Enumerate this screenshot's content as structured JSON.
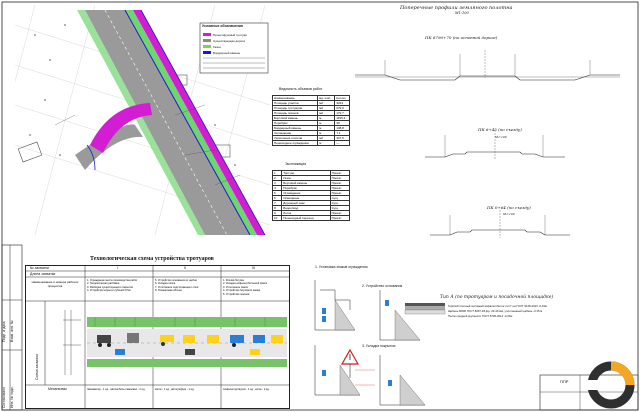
{
  "plan": {
    "legend_title": "Условные обозначения",
    "legend_items": [
      {
        "label": "Проектируемый тротуар",
        "color": "#d21dd2"
      },
      {
        "label": "Существующая дорога",
        "color": "#8a8a8a"
      },
      {
        "label": "Газон",
        "color": "#6fd66f"
      },
      {
        "label": "Бордюрный камень",
        "color": "#1a1ad0"
      }
    ]
  },
  "volumes": {
    "title": "Ведомость объемов работ",
    "headers": [
      "Наименование",
      "Ед. изм.",
      "Кол-во"
    ],
    "rows": [
      [
        "Площадь участка",
        "м2",
        "3224"
      ],
      [
        "Площадь тротуаров",
        "м2",
        "679,0"
      ],
      [
        "Площадь газонов",
        "м2",
        "172,7"
      ],
      [
        "Бортовой камень",
        "м",
        "1195,2"
      ],
      [
        "Поребрик",
        "м",
        "30"
      ],
      [
        "Бордюрный камень",
        "м",
        "138,8"
      ],
      [
        "Ограждение",
        "м",
        "7,1"
      ],
      [
        "Укрепление откосов",
        "м2",
        "307,6"
      ],
      [
        "Пешеходное ограждение",
        "м",
        "—"
      ]
    ]
  },
  "explication": {
    "title": "Экспликация",
    "rows": [
      [
        "1",
        "Тротуар",
        "Проект."
      ],
      [
        "2",
        "Газон",
        "Проект."
      ],
      [
        "3",
        "Бортовой камень",
        "Проект."
      ],
      [
        "4",
        "Поребрик",
        "Проект."
      ],
      [
        "5",
        "Ограждение",
        "Проект."
      ],
      [
        "6",
        "Освещение",
        "Сущ."
      ],
      [
        "7",
        "Дорожный знак",
        "Сущ."
      ],
      [
        "8",
        "Водоотвод",
        "Сущ."
      ],
      [
        "9",
        "Лоток",
        "Проект."
      ],
      [
        "10",
        "Пешеходный переход",
        "Проект."
      ]
    ]
  },
  "profiles": {
    "title": "Поперечные профили земляного полотна",
    "scale": "М1:100",
    "p1_title": "ПК 6790+70 (по основной дороге)",
    "p2_title": "ПК 6+45 (по съезду)",
    "p3_title": "ПК 0+64 (по съезду)",
    "type_a_title": "Тип А (по тротуарам и посадочной площадке)",
    "type_a_notes": [
      "Горячий плотный песчаный асфальтобетон тип Г на ГОСТ 9128-2013 -0,04м",
      "Щебень М600 ГОСТ 8267-93 фр. 20-40 мм, уплотненный щебень -0,15 м",
      "Песок средней крупности ГОСТ 8736-2014 -0,20м"
    ]
  },
  "tech": {
    "title": "Технологическая схема устройства тротуаров",
    "col_header_left": "№ захватки",
    "col_sub_left": "Длина захватки",
    "col_nums": [
      "I",
      "II",
      "III"
    ],
    "row1_label": "Наименование и номера рабочих процессов",
    "col1_text": [
      "1. Ограждение места производства работ",
      "2. Геодезическая разбивка",
      "3. Разборка существующего покрытия",
      "4. Устройство корыта глубиной 0,5м"
    ],
    "col2_text": [
      "5. Устройство основания из щебня",
      "6. Укладка песка",
      "7. Уплотнение подстилающего слоя",
      "8. Планировка обочин"
    ],
    "col3_text": [
      "1. Розлив битума",
      "2. Укладка асфальтобетонной смеси",
      "3. Уплотнение смеси",
      "4. Устройство бортового камня",
      "5. Устройство газонов"
    ],
    "side_label": "Схема захватки",
    "row3_label": "Механизмы",
    "bottom_texts": [
      "Экскаватор - 1 ед., автомобиль-самосвал - 2 ед.",
      "Каток - 1 ед., автогрейдер - 1 ед.",
      "Асфальтоукладчик - 1 ед., каток - 2 ед."
    ]
  },
  "stages": {
    "s1": "1. Установка знаков ограждения",
    "s2": "2. Устройство основания",
    "s3": "3. Укладка покрытия"
  },
  "stamp": {
    "label_ppr": "ППР",
    "side_labels": [
      "Согласовано",
      "Взам. инв. №",
      "Подп. и дата",
      "Инв. № подл."
    ]
  },
  "colors": {
    "sidewalk": "#d21dd2",
    "road": "#8a8a8a",
    "green": "#6fd66f",
    "curb": "#1a1ad0",
    "logo_orange": "#f5a623",
    "logo_dark": "#2f2f2f"
  }
}
